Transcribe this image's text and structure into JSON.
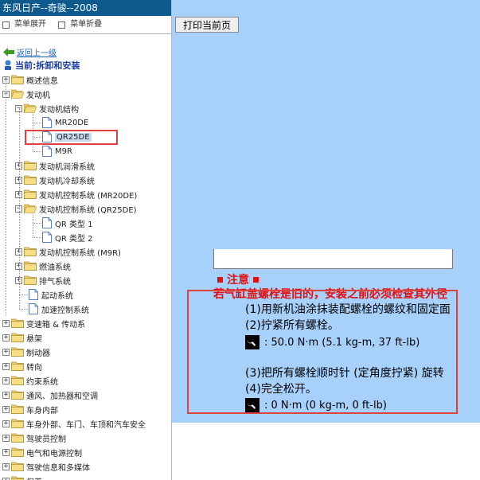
{
  "sidebar": {
    "title": "东风日产--奇骏--2008",
    "menu_expand": "菜单展开",
    "menu_collapse": "菜单折叠",
    "back_link": "返回上一级",
    "current": "当前:拆卸和安装",
    "tree": [
      {
        "label": "概述信息",
        "level": 0,
        "type": "folder",
        "expanded": false
      },
      {
        "label": "发动机",
        "level": 0,
        "type": "folder",
        "expanded": true
      },
      {
        "label": "发动机结构",
        "level": 1,
        "type": "folder",
        "expanded": true
      },
      {
        "label": "MR20DE",
        "level": 2,
        "type": "doc"
      },
      {
        "label": "QR25DE",
        "level": 2,
        "type": "doc",
        "selected": true
      },
      {
        "label": "M9R",
        "level": 2,
        "type": "doc"
      },
      {
        "label": "发动机润滑系统",
        "level": 1,
        "type": "folder",
        "expanded": false
      },
      {
        "label": "发动机冷却系统",
        "level": 1,
        "type": "folder",
        "expanded": false
      },
      {
        "label": "发动机控制系统 (MR20DE)",
        "level": 1,
        "type": "folder",
        "expanded": false
      },
      {
        "label": "发动机控制系统 (QR25DE)",
        "level": 1,
        "type": "folder",
        "expanded": true
      },
      {
        "label": "QR 类型 1",
        "level": 2,
        "type": "doc"
      },
      {
        "label": "QR 类型 2",
        "level": 2,
        "type": "doc"
      },
      {
        "label": "发动机控制系统 (M9R)",
        "level": 1,
        "type": "folder",
        "expanded": false
      },
      {
        "label": "燃油系统",
        "level": 1,
        "type": "folder",
        "expanded": false
      },
      {
        "label": "排气系统",
        "level": 1,
        "type": "folder",
        "expanded": false
      },
      {
        "label": "起动系统",
        "level": 1,
        "type": "doc"
      },
      {
        "label": "加速控制系统",
        "level": 1,
        "type": "doc"
      },
      {
        "label": "变速箱 & 传动系",
        "level": 0,
        "type": "folder",
        "expanded": false
      },
      {
        "label": "悬架",
        "level": 0,
        "type": "folder",
        "expanded": false
      },
      {
        "label": "制动器",
        "level": 0,
        "type": "folder",
        "expanded": false
      },
      {
        "label": "转向",
        "level": 0,
        "type": "folder",
        "expanded": false
      },
      {
        "label": "约束系统",
        "level": 0,
        "type": "folder",
        "expanded": false
      },
      {
        "label": "通风、加热器和空调",
        "level": 0,
        "type": "folder",
        "expanded": false
      },
      {
        "label": "车身内部",
        "level": 0,
        "type": "folder",
        "expanded": false
      },
      {
        "label": "车身外部、车门、车顶和汽车安全",
        "level": 0,
        "type": "folder",
        "expanded": false
      },
      {
        "label": "驾驶员控制",
        "level": 0,
        "type": "folder",
        "expanded": false
      },
      {
        "label": "电气和电源控制",
        "level": 0,
        "type": "folder",
        "expanded": false
      },
      {
        "label": "驾驶信息和多媒体",
        "level": 0,
        "type": "folder",
        "expanded": false
      },
      {
        "label": "保养",
        "level": 0,
        "type": "folder",
        "expanded": false
      }
    ]
  },
  "content": {
    "print_button": "打印当前页",
    "note_title": "注意",
    "warning": "若气缸盖螺栓是旧的，安装之前必须检查其外径",
    "steps": [
      "(1)用新机油涂抹装配螺栓的螺纹和固定面",
      "(2)拧紧所有螺栓。",
      "(3)把所有螺栓顺时针 (定角度拧紧) 旋转",
      "(4)完全松开。"
    ],
    "torques": [
      ": 50.0 N·m (5.1 kg-m, 37 ft-lb)",
      ": 0 N·m (0 kg-m, 0 ft-lb)"
    ]
  },
  "colors": {
    "title_bar": "#0e5a8c",
    "content_bg": "#a7d0fb",
    "highlight": "#e0413d",
    "warning_text": "#e01010",
    "link": "#1a63b8"
  }
}
